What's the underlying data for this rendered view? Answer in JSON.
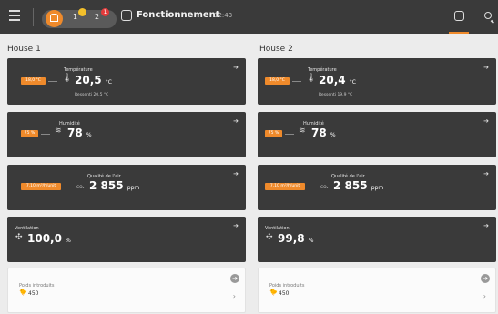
{
  "header": {
    "status_label": "Fonctionnement",
    "time": "12:43",
    "pill_items": [
      "1",
      "2"
    ],
    "badges": [
      {
        "text": "",
        "color": "#f3c02b"
      },
      {
        "text": "1",
        "color": "#e23b3b"
      }
    ]
  },
  "houses": [
    {
      "title": "House 1",
      "temperature": {
        "label": "Température",
        "setpoint": "18,0 °C",
        "value": "20,5",
        "unit": "°C",
        "sub": "Ressenti 20,5 °C"
      },
      "humidity": {
        "label": "Humidité",
        "setpoint": "75 %",
        "value": "78",
        "unit": "%"
      },
      "air": {
        "label": "Qualité de l'air",
        "setpoint": "7,10 m³/h/unit",
        "value": "2 855",
        "unit": "ppm",
        "prefix": "CO₂"
      },
      "ventilation": {
        "label": "Ventilation",
        "value": "100,0",
        "unit": "%"
      },
      "weight": {
        "label": "Poids introduits",
        "value": "450"
      }
    },
    {
      "title": "House 2",
      "temperature": {
        "label": "Température",
        "setpoint": "18,0 °C",
        "value": "20,4",
        "unit": "°C",
        "sub": "Ressenti 19,9 °C"
      },
      "humidity": {
        "label": "Humidité",
        "setpoint": "75 %",
        "value": "78",
        "unit": "%"
      },
      "air": {
        "label": "Qualité de l'air",
        "setpoint": "7,10 m³/h/unit",
        "value": "2 855",
        "unit": "ppm",
        "prefix": "CO₂"
      },
      "ventilation": {
        "label": "Ventilation",
        "value": "99,8",
        "unit": "%"
      },
      "weight": {
        "label": "Poids introduits",
        "value": "450"
      }
    }
  ],
  "colors": {
    "accent": "#ef8a2b",
    "card": "#3a3a3a",
    "bar": "#3a3a3a"
  },
  "icons": [
    "menu-icon",
    "home-icon",
    "status-icon",
    "search-icon",
    "arrow-right-icon",
    "thermometer-icon",
    "humidity-icon",
    "fan-icon",
    "chick-icon",
    "chevron-right-icon"
  ]
}
